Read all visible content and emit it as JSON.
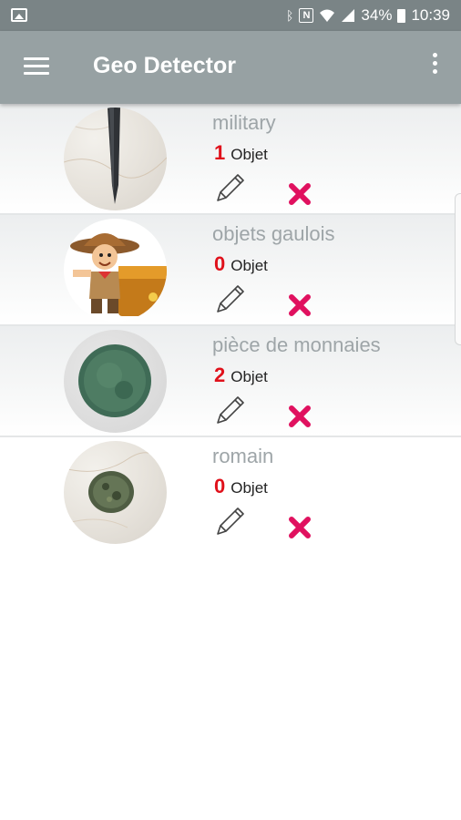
{
  "status_bar": {
    "battery": "34%",
    "time": "10:39"
  },
  "app_bar": {
    "title": "Geo Detector"
  },
  "items": [
    {
      "name": "military",
      "count": "1",
      "count_label": "Objet"
    },
    {
      "name": "objets gaulois",
      "count": "0",
      "count_label": "Objet"
    },
    {
      "name": "pièce de monnaies",
      "count": "2",
      "count_label": "Objet"
    },
    {
      "name": "romain",
      "count": "0",
      "count_label": "Objet"
    }
  ],
  "colors": {
    "status_bar": "#7a8486",
    "app_bar": "#97a1a3",
    "count": "#e0111b",
    "delete": "#e0115f"
  }
}
